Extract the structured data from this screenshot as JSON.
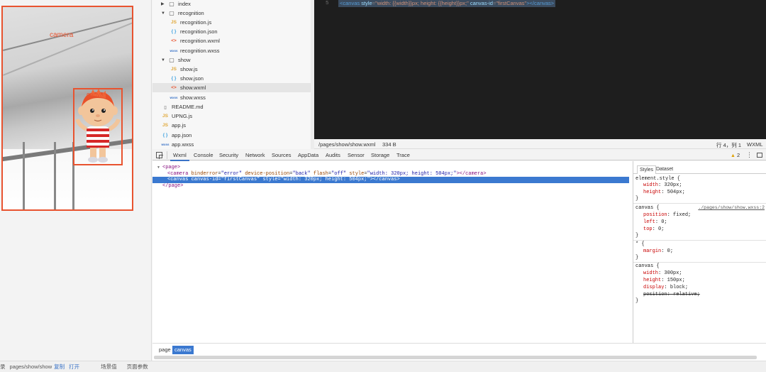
{
  "simulator": {
    "camera_label": "camera",
    "canvas_label": "canvas"
  },
  "status_bar": {
    "prefix": "录",
    "path": "pages/show/show",
    "copy": "复制",
    "open": "打开",
    "scene": "场景值",
    "params": "页面参数"
  },
  "file_tree": {
    "rows": [
      {
        "kind": "folder",
        "caret": "▶",
        "icon": "▢",
        "label": "index"
      },
      {
        "kind": "folder",
        "caret": "▼",
        "icon": "▢",
        "label": "recognition"
      },
      {
        "kind": "js",
        "icon": "JS",
        "label": "recognition.js"
      },
      {
        "kind": "json",
        "icon": "{ }",
        "label": "recognition.json"
      },
      {
        "kind": "wxml",
        "icon": "<>",
        "label": "recognition.wxml"
      },
      {
        "kind": "wxss",
        "icon": "wxss",
        "label": "recognition.wxss"
      },
      {
        "kind": "folder",
        "caret": "▼",
        "icon": "▢",
        "label": "show"
      },
      {
        "kind": "js",
        "icon": "JS",
        "label": "show.js"
      },
      {
        "kind": "json",
        "icon": "{ }",
        "label": "show.json"
      },
      {
        "kind": "wxml",
        "icon": "<>",
        "label": "show.wxml"
      },
      {
        "kind": "wxss",
        "icon": "wxss",
        "label": "show.wxss"
      },
      {
        "kind": "file",
        "icon": "▯",
        "label": "README.md"
      },
      {
        "kind": "js",
        "icon": "JS",
        "label": "UPNG.js"
      },
      {
        "kind": "js",
        "icon": "JS",
        "label": "app.js"
      },
      {
        "kind": "json",
        "icon": "{ }",
        "label": "app.json"
      },
      {
        "kind": "wxss",
        "icon": "wxss",
        "label": "app.wxss"
      }
    ]
  },
  "editor": {
    "line_number": "5",
    "code": {
      "open": "<canvas",
      "attr1": "style",
      "val1": "\"width: {{width}}px; height: {{height}}px;\"",
      "attr2": "canvas-id",
      "val2": "\"firstCanvas\"",
      "close": "></canvas>"
    },
    "status_path": "/pages/show/show.wxml",
    "status_size": "334 B",
    "status_pos": "行 4，列 1",
    "status_lang": "WXML"
  },
  "devtools": {
    "tabs": [
      "Wxml",
      "Console",
      "Security",
      "Network",
      "Sources",
      "AppData",
      "Audits",
      "Sensor",
      "Storage",
      "Trace"
    ],
    "active_tab": "Wxml",
    "warning_count": "2",
    "kebab": "⋮",
    "dom": {
      "page_open": "<page>",
      "camera": {
        "tag": "<camera",
        "a1": "binderror",
        "v1": "\"error\"",
        "a2": "device-position",
        "v2": "\"back\"",
        "a3": "flash",
        "v3": "\"off\"",
        "a4": "style",
        "v4": "\"width: 320px; height: 504px;\"",
        "close": "></camera>"
      },
      "canvas": {
        "tag": "<canvas",
        "a1": "canvas-id",
        "v1": "\"firstCanvas\"",
        "a2": "style",
        "v2": "\"width: 320px; height: 504px;\"",
        "close": "></canvas>"
      },
      "page_close": "</page>"
    },
    "styles": {
      "tab_styles": "Styles",
      "tab_dataset": "Dataset",
      "element_style": "element.style {",
      "es_width_prop": "width",
      "es_width_val": "320px;",
      "es_height_prop": "height",
      "es_height_val": "504px;",
      "brace_close": "}",
      "rule1_sel": "canvas {",
      "rule1_src": "./pages/show/show.wxss:2",
      "r1_pos_prop": "position",
      "r1_pos_val": "fixed;",
      "r1_left_prop": "left",
      "r1_left_val": "0;",
      "r1_top_prop": "top",
      "r1_top_val": "0;",
      "rule2_sel": "* {",
      "r2_margin_prop": "margin",
      "r2_margin_val": "0;",
      "rule3_sel": "canvas {",
      "r3_width_prop": "width",
      "r3_width_val": "300px;",
      "r3_height_prop": "height",
      "r3_height_val": "150px;",
      "r3_display_prop": "display",
      "r3_display_val": "block;",
      "r3_position": "position: relative;"
    },
    "breadcrumbs": [
      "page",
      "canvas"
    ]
  }
}
